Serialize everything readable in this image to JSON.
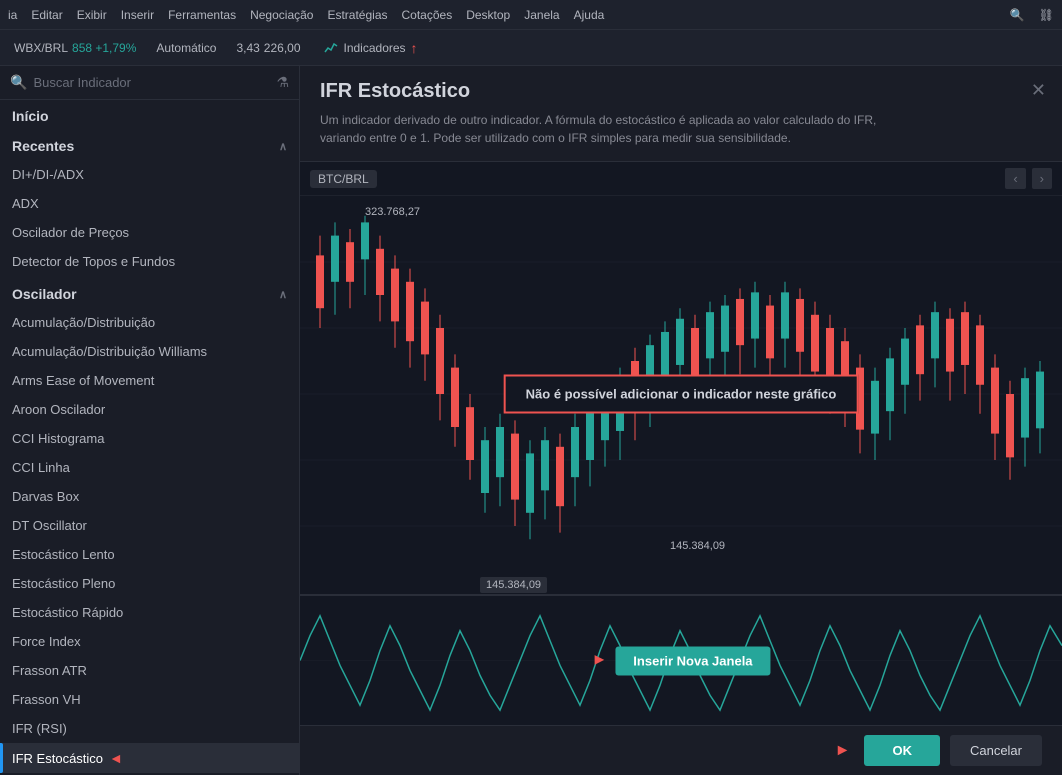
{
  "menubar": {
    "items": [
      "ia",
      "Editar",
      "Exibir",
      "Inserir",
      "Ferramentas",
      "Negociação",
      "Estratégias",
      "Cotações",
      "Desktop",
      "Janela",
      "Ajuda"
    ]
  },
  "toolbar": {
    "ticker": "WBX/BRL",
    "price": "858 +1,79%",
    "mode": "Automático",
    "price2": "3,43",
    "price3": "226,00",
    "indicators_label": "Indicadores"
  },
  "search": {
    "placeholder": "Buscar Indicador"
  },
  "nav": {
    "inicio": "Início"
  },
  "sections": {
    "recentes": {
      "label": "Recentes",
      "items": [
        "DI+/DI-/ADX",
        "ADX",
        "Oscilador de Preços",
        "Detector de Topos e Fundos"
      ]
    },
    "oscilador": {
      "label": "Oscilador",
      "items": [
        "Acumulação/Distribuição",
        "Acumulação/Distribuição Williams",
        "Arms Ease of Movement",
        "Aroon Oscilador",
        "CCI Histograma",
        "CCI Linha",
        "Darvas Box",
        "DT Oscillator",
        "Estocástico Lento",
        "Estocástico Pleno",
        "Estocástico Rápido",
        "Force Index",
        "Frasson ATR",
        "Frasson VH",
        "IFR (RSI)",
        "IFR Estocástico"
      ]
    }
  },
  "info_panel": {
    "title": "IFR Estocástico",
    "description": "Um indicador derivado de outro indicador. A fórmula do estocástico é aplicada ao valor calculado do IFR, variando entre 0 e 1. Pode ser utilizado com o IFR simples para medir sua sensibilidade."
  },
  "chart": {
    "pair": "BTC/BRL",
    "price_high": "323.768,27",
    "price_low": "145.384,09",
    "error_msg": "Não é possível adicionar o indicador neste gráfico",
    "insert_label": "Inserir Nova Janela",
    "bottom_price": "145.384,09"
  },
  "buttons": {
    "ok": "OK",
    "cancel": "Cancelar"
  },
  "icons": {
    "search": "🔍",
    "filter": "⚗",
    "chevron_up": "∧",
    "close": "✕",
    "arrow_left": "‹",
    "arrow_right": "›",
    "arrow_red": "►"
  }
}
